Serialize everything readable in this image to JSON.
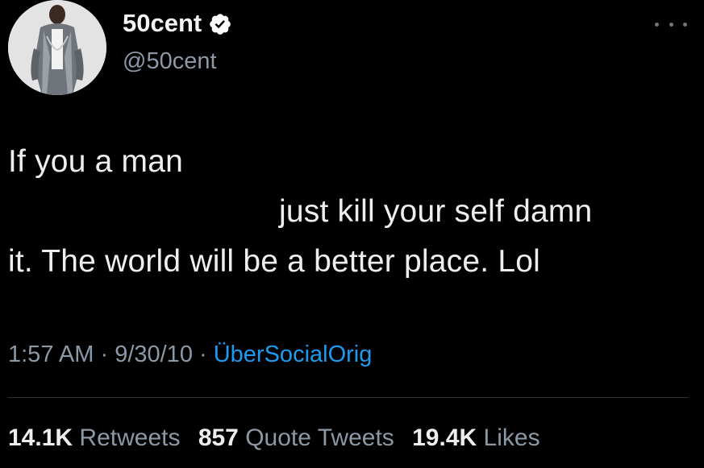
{
  "author": {
    "display_name": "50cent",
    "handle": "@50cent"
  },
  "icons": {
    "verified": "verified-badge-icon",
    "more": "more-options-icon"
  },
  "tweet": {
    "line1": "If you a man",
    "line2": "just kill your self damn",
    "line3": "it. The world will be a better place. Lol"
  },
  "meta": {
    "time": "1:57 AM",
    "sep1": " · ",
    "date": "9/30/10",
    "sep2": " · ",
    "source": "ÜberSocialOrig"
  },
  "stats": {
    "retweets_count": "14.1K",
    "retweets_label": "Retweets",
    "quote_count": "857",
    "quote_label": "Quote Tweets",
    "likes_count": "19.4K",
    "likes_label": "Likes"
  },
  "colors": {
    "background": "#000000",
    "secondary_text": "#8b98a5",
    "link": "#1d9bf0",
    "verified": "#ffffff"
  }
}
